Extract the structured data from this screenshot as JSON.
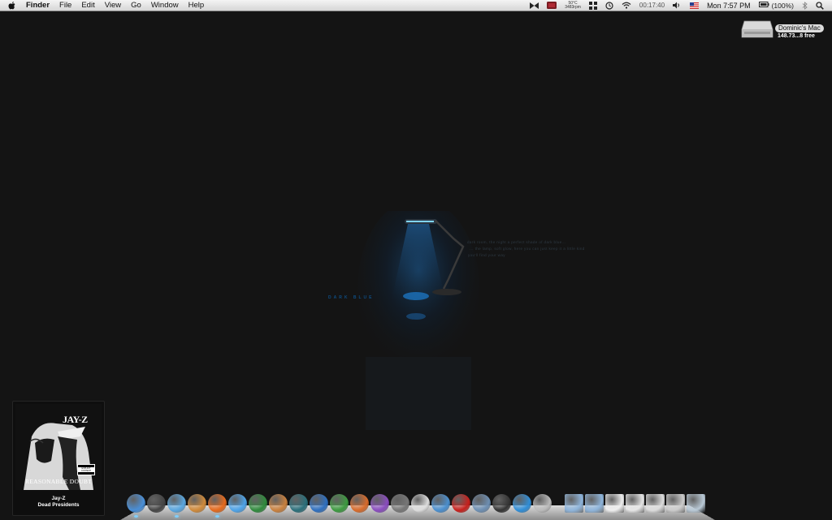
{
  "menubar": {
    "app_name": "Finder",
    "items": [
      "File",
      "Edit",
      "View",
      "Go",
      "Window",
      "Help"
    ],
    "status": {
      "temperature": "50°C",
      "fan_speed": "3483rpm",
      "timer": "00:17:40",
      "datetime": "Mon 7:57 PM",
      "battery": "(100%)"
    }
  },
  "desktop": {
    "drive_name": "Dominic's Mac",
    "drive_free": "148.73...8 free"
  },
  "wallpaper": {
    "brand": "DARK BLUE",
    "lines": [
      "dark room, the night a perfect shade of dark blue...",
      "... the lamp, soft glow, here you can just keep it a little kind",
      "you'll find your way"
    ]
  },
  "now_playing": {
    "artist": "Jay-Z",
    "track": "Dead Presidents",
    "album_art_artist": "JAY-Z",
    "album_art_title": "REASONABLE DOUBT",
    "parental_label": "EXPLICIT CONTENT"
  },
  "dock": {
    "apps": [
      {
        "icon": "finder-icon",
        "color": "#4a90d9",
        "running": true
      },
      {
        "icon": "dashboard-icon",
        "color": "#444",
        "running": false
      },
      {
        "icon": "itunes-icon",
        "color": "#5aa7e0",
        "running": true
      },
      {
        "icon": "garageband-icon",
        "color": "#d08a3a",
        "running": false
      },
      {
        "icon": "firefox-icon",
        "color": "#e66a1c",
        "running": true
      },
      {
        "icon": "safari-icon",
        "color": "#4da3e8",
        "running": false
      },
      {
        "icon": "numbers-icon",
        "color": "#2f8a3c",
        "running": false
      },
      {
        "icon": "keynote-icon",
        "color": "#c9803d",
        "running": false
      },
      {
        "icon": "time-machine-icon",
        "color": "#2a6f7a",
        "running": false
      },
      {
        "icon": "word-icon",
        "color": "#2e6fbf",
        "running": false
      },
      {
        "icon": "excel-icon",
        "color": "#3c9a3f",
        "running": false
      },
      {
        "icon": "powerpoint-icon",
        "color": "#d86b2a",
        "running": false
      },
      {
        "icon": "entourage-icon",
        "color": "#8a4cbf",
        "running": false
      },
      {
        "icon": "script-editor-icon",
        "color": "#777",
        "running": false
      },
      {
        "icon": "ical-icon",
        "color": "#ddd",
        "running": false
      },
      {
        "icon": "mail-bird-icon",
        "color": "#4a8fcf",
        "running": false
      },
      {
        "icon": "acrobat-icon",
        "color": "#c7201c",
        "running": false
      },
      {
        "icon": "preview-icon",
        "color": "#6d8fb3",
        "running": false
      },
      {
        "icon": "silhouette-icon",
        "color": "#333",
        "running": false
      },
      {
        "icon": "quicktime-icon",
        "color": "#2f8ed8",
        "running": false
      },
      {
        "icon": "photo-tool-icon",
        "color": "#bbb",
        "running": false
      }
    ],
    "docs": [
      {
        "icon": "folder-icon",
        "color": "#8fb5db"
      },
      {
        "icon": "downloads-folder-icon",
        "color": "#8fb5db"
      },
      {
        "icon": "document-stack-icon",
        "color": "#eee"
      },
      {
        "icon": "document-stack-2-icon",
        "color": "#e6e6e6"
      },
      {
        "icon": "screenshot-stack-icon",
        "color": "#ddd"
      },
      {
        "icon": "window-stack-icon",
        "color": "#ccc"
      },
      {
        "icon": "trash-icon",
        "color": "#b9c9d6"
      }
    ]
  }
}
